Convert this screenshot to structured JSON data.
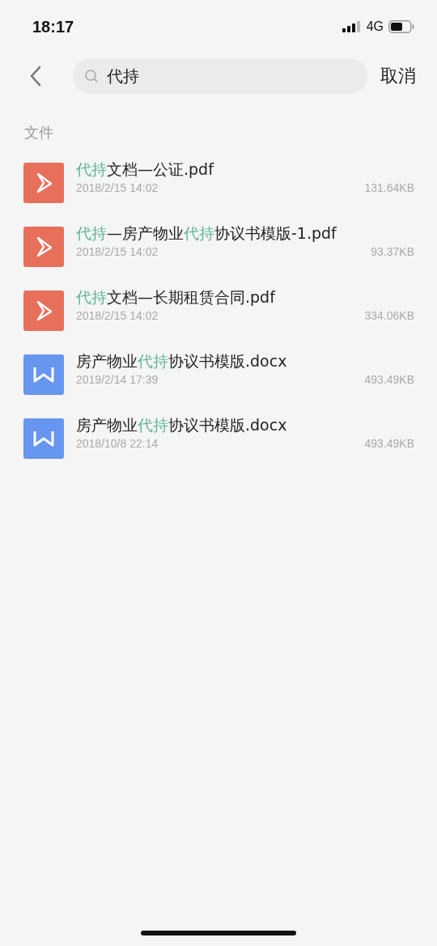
{
  "status_bar": {
    "time": "18:17",
    "network": "4G"
  },
  "search": {
    "value": "代持",
    "cancel": "取消"
  },
  "section_title": "文件",
  "files": [
    {
      "kind": "pdf",
      "name": [
        {
          "text": "代持",
          "highlight": true
        },
        {
          "text": "文档—公证.pdf",
          "highlight": false
        }
      ],
      "date": "2018/2/15 14:02",
      "size": "131.64KB"
    },
    {
      "kind": "pdf",
      "name": [
        {
          "text": "代持",
          "highlight": true
        },
        {
          "text": "—房产物业",
          "highlight": false
        },
        {
          "text": "代持",
          "highlight": true
        },
        {
          "text": "协议书模版-1.pdf",
          "highlight": false
        }
      ],
      "date": "2018/2/15 14:02",
      "size": "93.37KB"
    },
    {
      "kind": "pdf",
      "name": [
        {
          "text": "代持",
          "highlight": true
        },
        {
          "text": "文档—长期租赁合同.pdf",
          "highlight": false
        }
      ],
      "date": "2018/2/15 14:02",
      "size": "334.06KB"
    },
    {
      "kind": "docx",
      "name": [
        {
          "text": "房产物业",
          "highlight": false
        },
        {
          "text": "代持",
          "highlight": true
        },
        {
          "text": "协议书模版.docx",
          "highlight": false
        }
      ],
      "date": "2019/2/14 17:39",
      "size": "493.49KB"
    },
    {
      "kind": "docx",
      "name": [
        {
          "text": "房产物业",
          "highlight": false
        },
        {
          "text": "代持",
          "highlight": true
        },
        {
          "text": "协议书模版.docx",
          "highlight": false
        }
      ],
      "date": "2018/10/8 22:14",
      "size": "493.49KB"
    }
  ]
}
